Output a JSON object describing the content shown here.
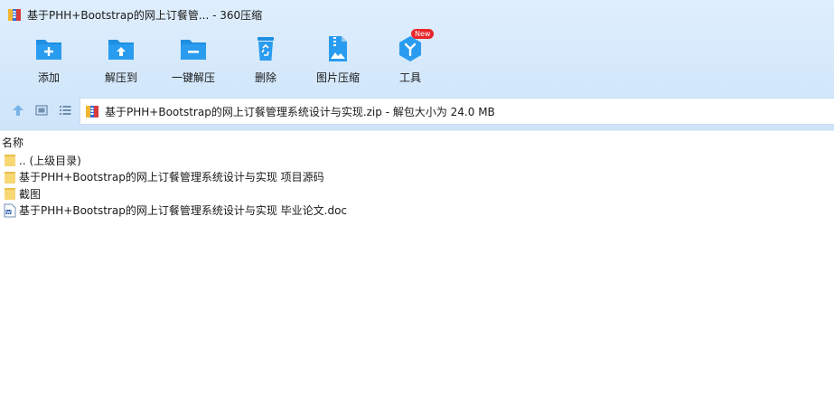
{
  "window": {
    "title": "基于PHH+Bootstrap的网上订餐管... - 360压缩"
  },
  "toolbar": {
    "items": [
      {
        "label": "添加",
        "icon": "add-folder-icon"
      },
      {
        "label": "解压到",
        "icon": "extract-to-folder-icon"
      },
      {
        "label": "一键解压",
        "icon": "one-click-extract-icon"
      },
      {
        "label": "删除",
        "icon": "recycle-bin-icon"
      },
      {
        "label": "图片压缩",
        "icon": "image-compress-icon"
      },
      {
        "label": "工具",
        "icon": "tools-icon",
        "badge": "New"
      }
    ]
  },
  "address": {
    "icons": [
      "up-arrow-icon",
      "view-icon",
      "list-view-icon"
    ],
    "path": "基于PHH+Bootstrap的网上订餐管理系统设计与实现.zip - 解包大小为 24.0 MB"
  },
  "columns": {
    "name": "名称"
  },
  "files": [
    {
      "name": ".. (上级目录)",
      "type": "folder"
    },
    {
      "name": "基于PHH+Bootstrap的网上订餐管理系统设计与实现 项目源码",
      "type": "folder"
    },
    {
      "name": "截图",
      "type": "folder"
    },
    {
      "name": "基于PHH+Bootstrap的网上订餐管理系统设计与实现 毕业论文.doc",
      "type": "doc"
    }
  ],
  "colors": {
    "accent": "#1e8fe1",
    "toolbar_bg": "#d6e9fb",
    "folder": "#f8d775",
    "badge": "#e8262b"
  }
}
